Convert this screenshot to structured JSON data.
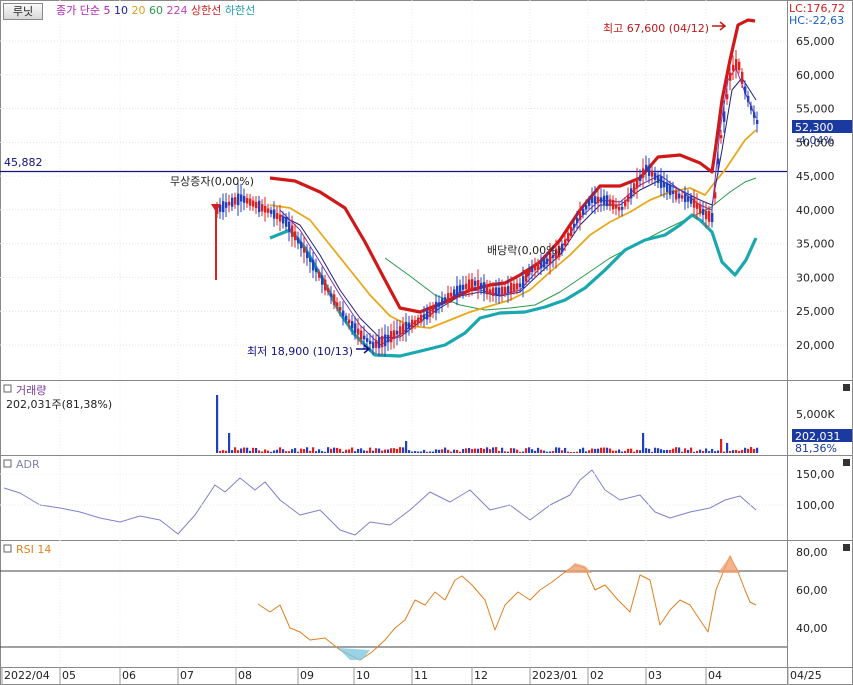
{
  "toolbar": {
    "button": "루닛"
  },
  "main": {
    "ma_labels": [
      {
        "text": "종가 단순",
        "color": "#b020b0"
      },
      {
        "text": "5",
        "color": "#b020b0"
      },
      {
        "text": "10",
        "color": "#1a1aa0"
      },
      {
        "text": "20",
        "color": "#e0a020"
      },
      {
        "text": "60",
        "color": "#2a9a4a"
      },
      {
        "text": "224",
        "color": "#c040c0"
      },
      {
        "text": "상한선",
        "color": "#d02020"
      },
      {
        "text": "하한선",
        "color": "#20a0a8"
      }
    ],
    "lc_label": "LC:176,72",
    "hc_label": "HC:-22,63",
    "yticks": [
      "65,000",
      "60,000",
      "55,000",
      "50,000",
      "45,000",
      "40,000",
      "35,000",
      "30,000",
      "25,000",
      "20,000"
    ],
    "hline_label": "45,882",
    "high_annotation": "최고 67,600 (04/12)",
    "low_annotation": "최저 18,900 (10/13)",
    "event1": "무상증자(0,00%)",
    "event2": "배당락(0,00%)",
    "price_tag": "52,300",
    "change_tag": "-4,04%"
  },
  "volume": {
    "title": "거래량",
    "value": "202,031주(81,38%)",
    "ytick": "5,000K",
    "tag": "202,031",
    "pct": "81,36%"
  },
  "adr": {
    "title": "ADR",
    "yticks": [
      "150,00",
      "100,00"
    ]
  },
  "rsi": {
    "title": "RSI 14",
    "yticks": [
      "80,00",
      "60,00",
      "40,00"
    ]
  },
  "xaxis": [
    "2022/04",
    "05",
    "06",
    "07",
    "08",
    "09",
    "10",
    "11",
    "12",
    "2023/01",
    "02",
    "03",
    "04",
    "04/25"
  ],
  "colors": {
    "upper": "#d01818",
    "lower": "#1aa8b0",
    "ma20": "#e8a818",
    "ma60": "#2a9a4a",
    "ma5": "#8030b0",
    "ma10": "#202080",
    "up": "#e02020",
    "down": "#2040c0",
    "hline": "#101080",
    "rsi": "#e08020",
    "adr": "#8080d0"
  }
}
